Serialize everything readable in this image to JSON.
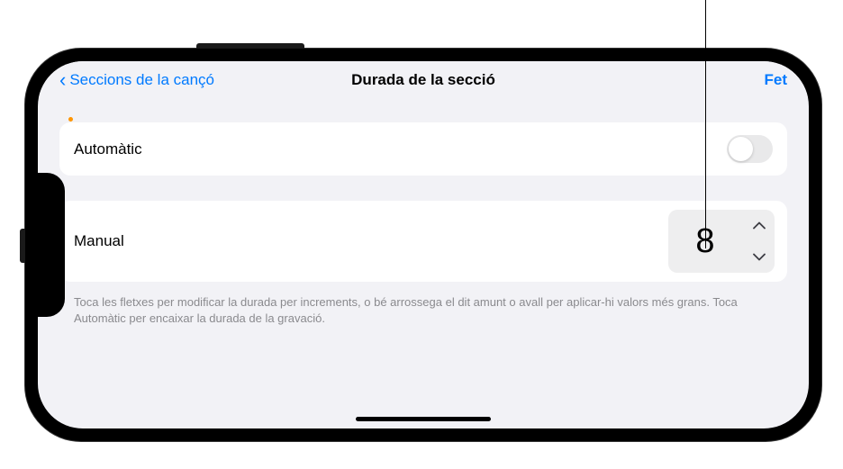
{
  "nav": {
    "back_label": "Seccions de la cançó",
    "title": "Durada de la secció",
    "done_label": "Fet"
  },
  "automatic": {
    "label": "Automàtic",
    "on": false
  },
  "manual": {
    "label": "Manual",
    "value": "8"
  },
  "footer": "Toca les fletxes per modificar la durada per increments, o bé arrossega el dit amunt o avall per aplicar-hi valors més grans. Toca Automàtic per encaixar la durada de la gravació."
}
